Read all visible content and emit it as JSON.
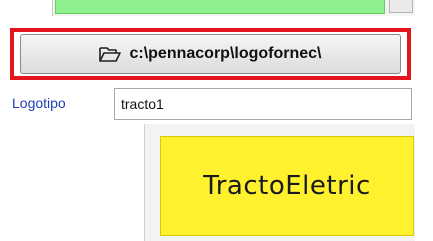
{
  "folder_button": {
    "label": "c:\\pennacorp\\logofornec\\",
    "icon": "folder-open-icon"
  },
  "logotipo": {
    "label": "Logotipo",
    "value": "tracto1"
  },
  "preview": {
    "logo_text": "TractoEletric",
    "background_color": "#fff12e"
  },
  "colors": {
    "highlight": "#e3161e",
    "field_green": "#8ef08e",
    "label_blue": "#1f3fb6"
  }
}
